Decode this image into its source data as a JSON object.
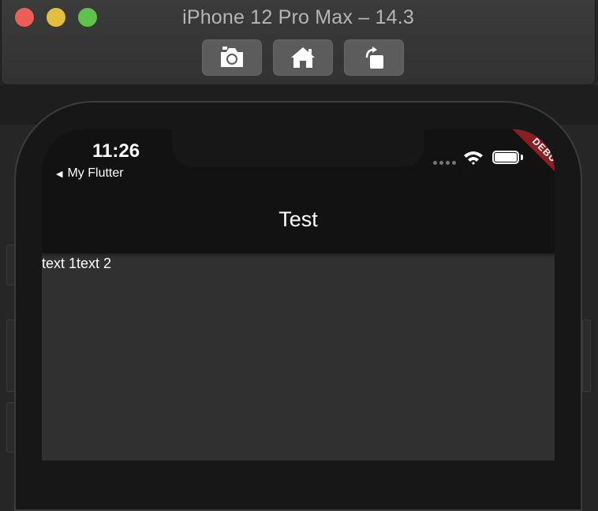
{
  "window": {
    "title": "iPhone 12 Pro Max – 14.3",
    "toolbar": [
      {
        "name": "screenshot-button",
        "icon": "camera-icon"
      },
      {
        "name": "home-button",
        "icon": "home-icon"
      },
      {
        "name": "rotate-button",
        "icon": "rotate-icon"
      }
    ]
  },
  "status_bar": {
    "time": "11:26",
    "back_app": "My Flutter"
  },
  "app_bar": {
    "title": "Test",
    "debug_banner": "DEBUG"
  },
  "body": {
    "text": "text 1text 2"
  },
  "colors": {
    "close": "#ec5f57",
    "minimize": "#e2bd3f",
    "maximize": "#5fc24a",
    "debug_banner": "#8a1f1f",
    "app_bar": "#121212",
    "scaffold": "#303030"
  }
}
